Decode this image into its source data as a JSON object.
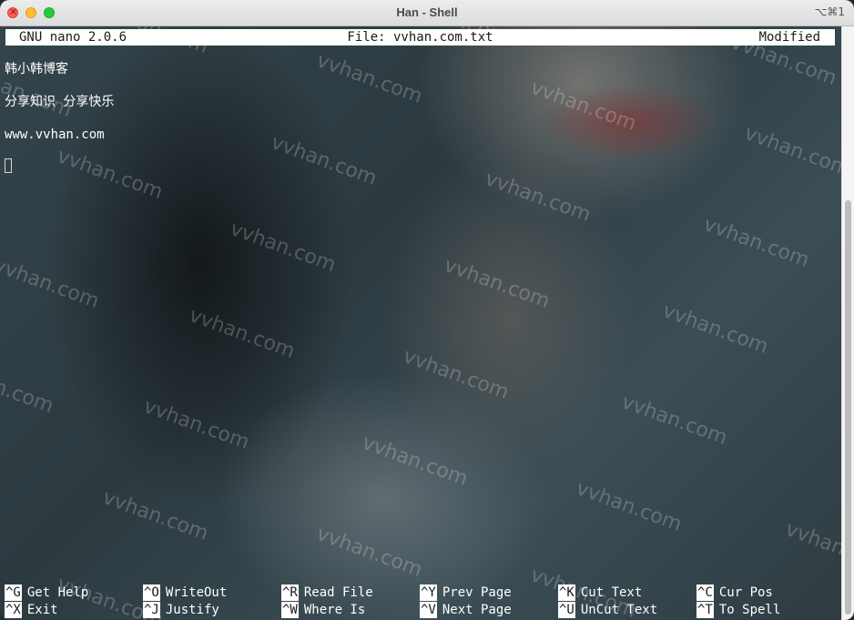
{
  "window": {
    "title": "Han - Shell",
    "shortcut_hint": "⌥⌘1"
  },
  "nano": {
    "version": "GNU nano 2.0.6",
    "file": "File: vvhan.com.txt",
    "status": "Modified"
  },
  "content": {
    "lines": [
      "韩小韩博客",
      "分享知识 分享快乐",
      "www.vvhan.com"
    ]
  },
  "shortcuts": [
    {
      "key": "^G",
      "label": "Get Help"
    },
    {
      "key": "^O",
      "label": "WriteOut"
    },
    {
      "key": "^R",
      "label": "Read File"
    },
    {
      "key": "^Y",
      "label": "Prev Page"
    },
    {
      "key": "^K",
      "label": "Cut Text"
    },
    {
      "key": "^C",
      "label": "Cur Pos"
    },
    {
      "key": "^X",
      "label": "Exit"
    },
    {
      "key": "^J",
      "label": "Justify"
    },
    {
      "key": "^W",
      "label": "Where Is"
    },
    {
      "key": "^V",
      "label": "Next Page"
    },
    {
      "key": "^U",
      "label": "UnCut Text"
    },
    {
      "key": "^T",
      "label": "To Spell"
    }
  ],
  "watermark": "vvhan.com",
  "colors": {
    "close": "#ff5f57",
    "minimize": "#febc2e",
    "maximize": "#28c840",
    "header_bg": "#ffffff",
    "text": "#ffffff"
  }
}
